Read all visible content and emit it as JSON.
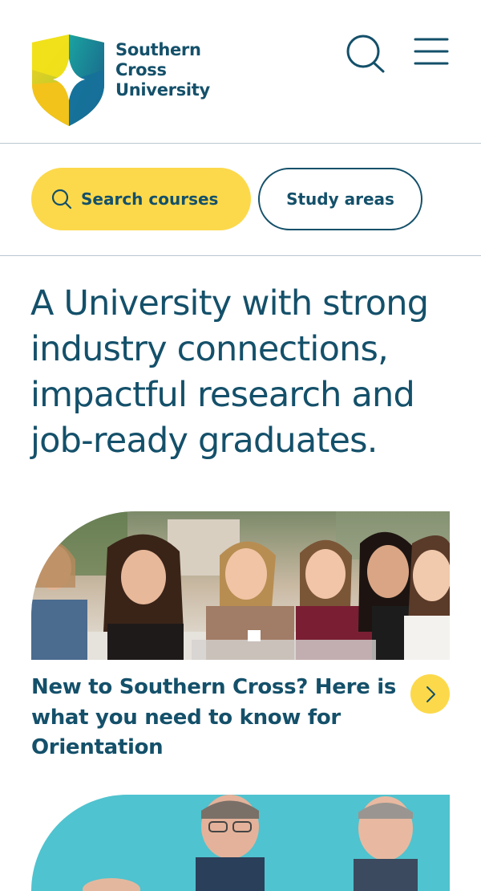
{
  "header": {
    "logo_lines": [
      "Southern",
      "Cross",
      "University"
    ],
    "search_icon": "search-icon",
    "menu_icon": "hamburger-menu-icon"
  },
  "actions": {
    "search_courses_label": "Search courses",
    "study_areas_label": "Study areas"
  },
  "hero": {
    "headline": "A University with strong industry connections, impactful research and job-ready graduates."
  },
  "cards": [
    {
      "title": "New to Southern Cross? Here is what you need to know for Orientation",
      "image": "group-of-smiling-students-photo",
      "arrow_icon": "chevron-right-icon"
    },
    {
      "image": "staff-portraits-photo"
    }
  ],
  "colors": {
    "brand_navy": "#14506a",
    "accent_yellow": "#fcd94b",
    "divider": "#b9c7d1"
  }
}
